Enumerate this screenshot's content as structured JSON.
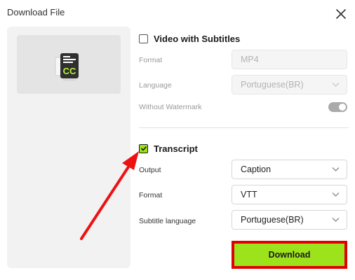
{
  "dialog": {
    "title": "Download File"
  },
  "video_subtitles": {
    "label": "Video with Subtitles",
    "checked": false,
    "format_label": "Format",
    "format_value": "MP4",
    "language_label": "Language",
    "language_value": "Portuguese(BR)",
    "watermark_label": "Without Watermark",
    "watermark_on": true
  },
  "transcript": {
    "label": "Transcript",
    "checked": true,
    "output_label": "Output",
    "output_value": "Caption",
    "format_label": "Format",
    "format_value": "VTT",
    "subtitle_language_label": "Subtitle language",
    "subtitle_language_value": "Portuguese(BR)"
  },
  "actions": {
    "download_label": "Download"
  },
  "icons": {
    "close": "close-icon",
    "preview": "cc-file-icon",
    "chevron": "chevron-down-icon",
    "check": "check-icon"
  },
  "colors": {
    "accent": "#9ce31c",
    "highlight": "#e00000",
    "panel": "#f2f2f2"
  }
}
